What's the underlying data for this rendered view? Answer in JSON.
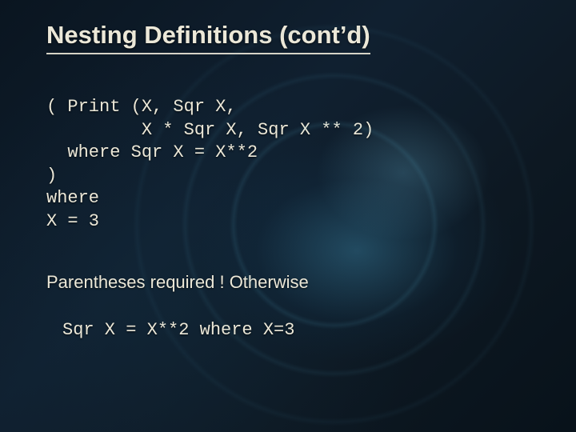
{
  "title": "Nesting Definitions (cont’d)",
  "code": {
    "l1": "( Print (X, Sqr X,",
    "l2": "         X * Sqr X, Sqr X ** 2)",
    "l3": "  where Sqr X = X**2",
    "l4": ")",
    "l5": "where",
    "l6": "X = 3"
  },
  "note": "Parentheses required ! Otherwise",
  "inline_code": "Sqr X = X**2 where X=3"
}
